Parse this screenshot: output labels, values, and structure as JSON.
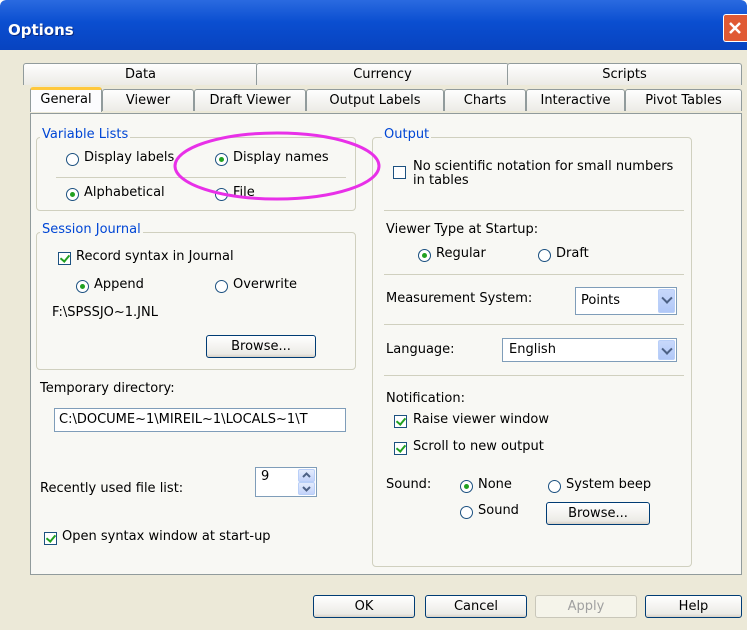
{
  "window": {
    "title": "Options"
  },
  "tabs": {
    "row1": [
      "Data",
      "Currency",
      "Scripts"
    ],
    "row2": [
      "General",
      "Viewer",
      "Draft Viewer",
      "Output Labels",
      "Charts",
      "Interactive",
      "Pivot Tables"
    ],
    "active": "General"
  },
  "variable_lists": {
    "label": "Variable Lists",
    "display_labels": "Display labels",
    "display_names": "Display names",
    "alphabetical": "Alphabetical",
    "file": "File"
  },
  "session_journal": {
    "label": "Session Journal",
    "record_syntax": "Record syntax in Journal",
    "append": "Append",
    "overwrite": "Overwrite",
    "path": "F:\\SPSSJO~1.JNL",
    "browse": "Browse..."
  },
  "temporary_directory": {
    "label": "Temporary directory:",
    "value": "C:\\DOCUME~1\\MIREIL~1\\LOCALS~1\\T"
  },
  "recent_files": {
    "label": "Recently used file list:",
    "value": "9"
  },
  "open_syntax": "Open syntax window at start-up",
  "output": {
    "label": "Output",
    "no_scientific": "No scientific notation for small numbers",
    "no_scientific_2": "in tables",
    "viewer_type_label": "Viewer Type at Startup:",
    "regular": "Regular",
    "draft": "Draft",
    "measurement_label": "Measurement System:",
    "measurement_value": "Points",
    "language_label": "Language:",
    "language_value": "English",
    "notification_label": "Notification:",
    "raise_viewer": "Raise viewer window",
    "scroll_output": "Scroll to new output",
    "sound_label": "Sound:",
    "sound_none": "None",
    "sound_beep": "System beep",
    "sound_sound": "Sound",
    "sound_browse": "Browse..."
  },
  "buttons": {
    "ok": "OK",
    "cancel": "Cancel",
    "apply": "Apply",
    "help": "Help"
  },
  "highlight_color": "#e830e8"
}
